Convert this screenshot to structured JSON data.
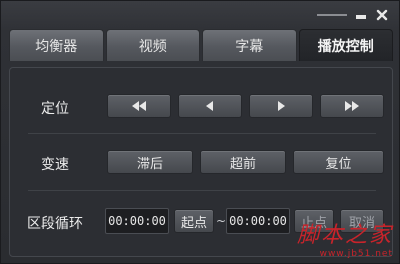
{
  "tabs": [
    {
      "label": "均衡器",
      "active": false
    },
    {
      "label": "视频",
      "active": false
    },
    {
      "label": "字幕",
      "active": false
    },
    {
      "label": "播放控制",
      "active": true
    }
  ],
  "positioning": {
    "label": "定位",
    "buttons": [
      "rewind-icon",
      "step-back-icon",
      "step-forward-icon",
      "fast-forward-icon"
    ]
  },
  "speed": {
    "label": "变速",
    "slower_label": "滞后",
    "faster_label": "超前",
    "reset_label": "复位"
  },
  "loop": {
    "label": "区段循环",
    "start_time": "00:00:00",
    "start_button_label": "起点",
    "separator": "~",
    "end_time": "00:00:00",
    "end_button_label": "止点",
    "cancel_button_label": "取消"
  },
  "watermark": {
    "text": "脚本之家",
    "url": "www.jb51.net"
  },
  "colors": {
    "active_tab": "#222428",
    "watermark": "#c8242b"
  }
}
